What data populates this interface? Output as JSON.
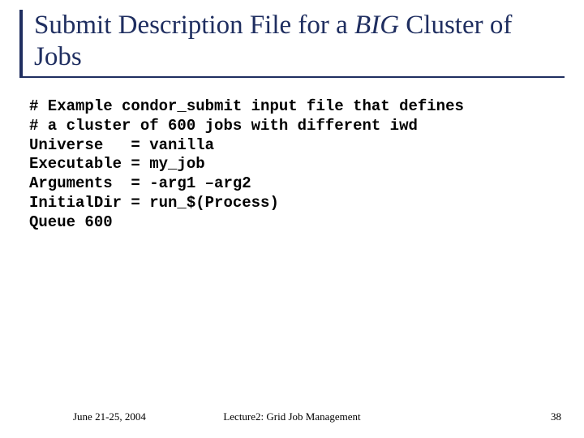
{
  "title": {
    "prefix": "Submit Description File for a ",
    "italic": "BIG",
    "suffix": " Cluster of Jobs"
  },
  "code": {
    "line1": "# Example condor_submit input file that defines",
    "line2": "# a cluster of 600 jobs with different iwd",
    "line3": "Universe   = vanilla",
    "line4": "Executable = my_job",
    "line5": "Arguments  = -arg1 –arg2",
    "line6": "InitialDir = run_$(Process)",
    "line7": "Queue 600"
  },
  "footer": {
    "date": "June 21-25, 2004",
    "lecture": "Lecture2: Grid Job Management",
    "page": "38"
  }
}
